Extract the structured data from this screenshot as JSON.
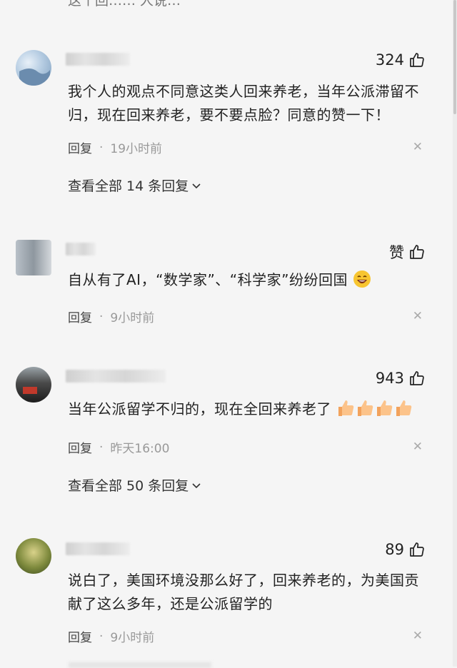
{
  "top_partial_text": "这个回…… 人说…",
  "comments": [
    {
      "likes": "324",
      "text": "我个人的观点不同意这类人回来养老，当年公派滞留不归，现在回来养老，要不要点脸？同意的赞一下！",
      "reply_label": "回复",
      "separator": "·",
      "time": "19小时前",
      "view_all": "查看全部 14 条回复"
    },
    {
      "likes": "赞",
      "text": "自从有了AI，“数学家”、“科学家”纷纷回国",
      "reply_label": "回复",
      "separator": "·",
      "time": "9小时前"
    },
    {
      "likes": "943",
      "text": "当年公派留学不归的，现在全回来养老了",
      "reply_label": "回复",
      "separator": "·",
      "time": "昨天16:00",
      "view_all": "查看全部 50 条回复"
    },
    {
      "likes": "89",
      "text": "说白了，美国环境没那么好了，回来养老的，为美国贡献了这么多年，还是公派留学的",
      "reply_label": "回复",
      "separator": "·",
      "time": "9小时前"
    }
  ],
  "icons": {
    "like": "thumbs-up-icon",
    "close": "close-icon",
    "chevron": "chevron-down-icon",
    "laugh_emoji": "grinning-emoji",
    "thumb_emoji": "thumbs-up-emoji"
  },
  "colors": {
    "background": "#f5f5f5",
    "text": "#222222",
    "secondary": "#999999"
  }
}
